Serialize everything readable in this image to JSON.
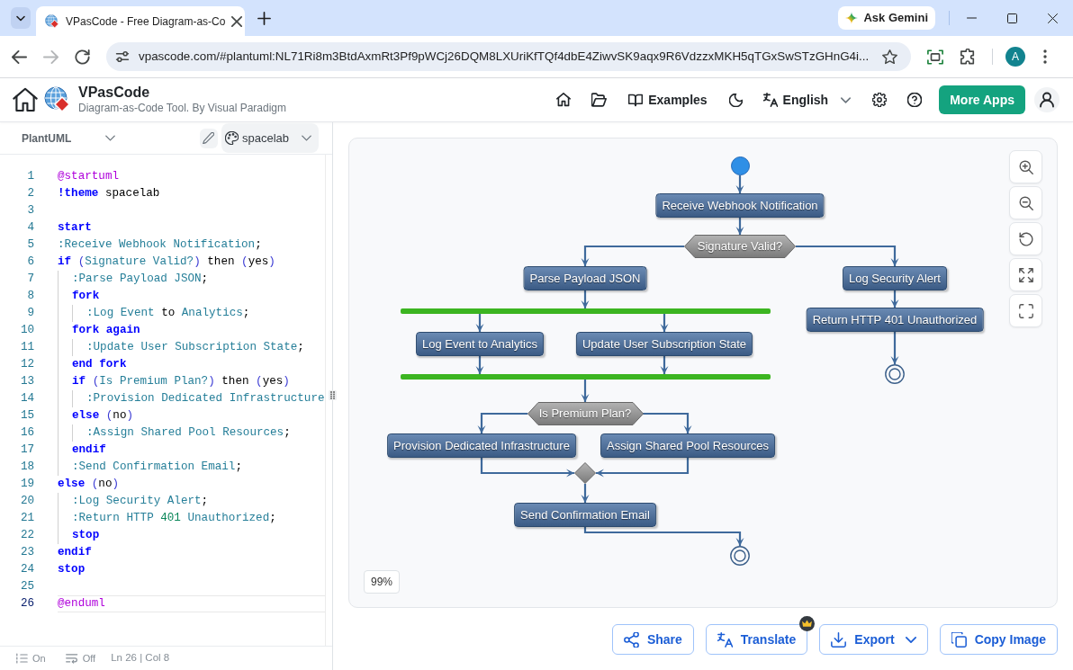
{
  "browser": {
    "tab_title": "VPasCode - Free Diagram-as-Co",
    "gemini": "Ask Gemini",
    "forward_disabled": true,
    "url": "vpascode.com/#plantuml:NL71Ri8m3BtdAxmRt3Pf9pWCj26DQM8LXUriKfTQf4dbE4ZiwvSK9aqx9R6VdzzxMKH5qTGxSwSTzGHnG4i...",
    "profile_initial": "A"
  },
  "header": {
    "title": "VPasCode",
    "subtitle": "Diagram-as-Code Tool. By Visual Paradigm",
    "examples": "Examples",
    "language": "English",
    "more_apps": "More Apps"
  },
  "editor": {
    "language": "PlantUML",
    "theme": "spacelab",
    "lines": [
      {
        "number": "1",
        "current": false,
        "tokens": [
          {
            "text": "@startuml",
            "kind": "directive"
          }
        ]
      },
      {
        "number": "2",
        "current": false,
        "tokens": [
          {
            "text": "!theme",
            "kind": "keyword"
          },
          {
            "text": " spacelab",
            "kind": "plain"
          }
        ]
      },
      {
        "number": "3",
        "current": false
      },
      {
        "number": "4",
        "current": false,
        "tokens": [
          {
            "text": "start",
            "kind": "keyword"
          }
        ]
      },
      {
        "number": "5",
        "current": false,
        "tokens": [
          {
            "text": ":Receive Webhook Notification",
            "kind": "label"
          },
          {
            "text": ";",
            "kind": "plain"
          }
        ]
      },
      {
        "number": "6",
        "current": false,
        "tokens": [
          {
            "text": "if",
            "kind": "keyword"
          },
          {
            "text": " (",
            "kind": "paren"
          },
          {
            "text": "Signature Valid?",
            "kind": "label"
          },
          {
            "text": ")",
            "kind": "paren"
          },
          {
            "text": " then ",
            "kind": "plain"
          },
          {
            "text": "(",
            "kind": "paren"
          },
          {
            "text": "yes",
            "kind": "plain"
          },
          {
            "text": ")",
            "kind": "paren"
          }
        ],
        "children": [
          {
            "number": "7",
            "current": false,
            "tokens": [
              {
                "text": ":Parse Payload JSON",
                "kind": "label"
              },
              {
                "text": ";",
                "kind": "plain"
              }
            ]
          },
          {
            "number": "8",
            "current": false,
            "tokens": [
              {
                "text": "fork",
                "kind": "keyword"
              }
            ],
            "children": [
              {
                "number": "9",
                "current": false,
                "tokens": [
                  {
                    "text": ":Log Event",
                    "kind": "label"
                  },
                  {
                    "text": " to ",
                    "kind": "plain"
                  },
                  {
                    "text": "Analytics",
                    "kind": "label"
                  },
                  {
                    "text": ";",
                    "kind": "plain"
                  }
                ]
              }
            ]
          },
          {
            "number": "10",
            "current": false,
            "tokens": [
              {
                "text": "fork again",
                "kind": "keyword"
              }
            ],
            "children": [
              {
                "number": "11",
                "current": false,
                "tokens": [
                  {
                    "text": ":Update User Subscription State",
                    "kind": "label"
                  },
                  {
                    "text": ";",
                    "kind": "plain"
                  }
                ]
              }
            ]
          },
          {
            "number": "12",
            "current": false,
            "tokens": [
              {
                "text": "end fork",
                "kind": "keyword"
              }
            ]
          },
          {
            "number": "13",
            "current": false,
            "tokens": [
              {
                "text": "if",
                "kind": "keyword"
              },
              {
                "text": " (",
                "kind": "paren"
              },
              {
                "text": "Is Premium Plan?",
                "kind": "label"
              },
              {
                "text": ")",
                "kind": "paren"
              },
              {
                "text": " then ",
                "kind": "plain"
              },
              {
                "text": "(",
                "kind": "paren"
              },
              {
                "text": "yes",
                "kind": "plain"
              },
              {
                "text": ")",
                "kind": "paren"
              }
            ],
            "children": [
              {
                "number": "14",
                "current": false,
                "tokens": [
                  {
                    "text": ":Provision Dedicated Infrastructure",
                    "kind": "label"
                  }
                ]
              }
            ]
          },
          {
            "number": "15",
            "current": false,
            "tokens": [
              {
                "text": "else",
                "kind": "keyword"
              },
              {
                "text": " (",
                "kind": "paren"
              },
              {
                "text": "no",
                "kind": "plain"
              },
              {
                "text": ")",
                "kind": "paren"
              }
            ],
            "children": [
              {
                "number": "16",
                "current": false,
                "tokens": [
                  {
                    "text": ":Assign Shared Pool Resources",
                    "kind": "label"
                  },
                  {
                    "text": ";",
                    "kind": "plain"
                  }
                ]
              }
            ]
          },
          {
            "number": "17",
            "current": false,
            "tokens": [
              {
                "text": "endif",
                "kind": "keyword"
              }
            ]
          },
          {
            "number": "18",
            "current": false,
            "tokens": [
              {
                "text": ":Send Confirmation Email",
                "kind": "label"
              },
              {
                "text": ";",
                "kind": "plain"
              }
            ]
          }
        ]
      },
      {
        "number": "19",
        "current": false,
        "tokens": [
          {
            "text": "else",
            "kind": "keyword"
          },
          {
            "text": " (",
            "kind": "paren"
          },
          {
            "text": "no",
            "kind": "plain"
          },
          {
            "text": ")",
            "kind": "paren"
          }
        ],
        "children": [
          {
            "number": "20",
            "current": false,
            "tokens": [
              {
                "text": ":Log Security Alert",
                "kind": "label"
              },
              {
                "text": ";",
                "kind": "plain"
              }
            ]
          },
          {
            "number": "21",
            "current": false,
            "tokens": [
              {
                "text": ":Return HTTP ",
                "kind": "label"
              },
              {
                "text": "401",
                "kind": "number"
              },
              {
                "text": " Unauthorized",
                "kind": "label"
              },
              {
                "text": ";",
                "kind": "plain"
              }
            ]
          },
          {
            "number": "22",
            "current": false,
            "tokens": [
              {
                "text": "stop",
                "kind": "keyword"
              }
            ]
          }
        ]
      },
      {
        "number": "23",
        "current": false,
        "tokens": [
          {
            "text": "endif",
            "kind": "keyword"
          }
        ]
      },
      {
        "number": "24",
        "current": false,
        "tokens": [
          {
            "text": "stop",
            "kind": "keyword"
          }
        ]
      },
      {
        "number": "25",
        "current": false
      },
      {
        "number": "26",
        "current": true,
        "tokens": [
          {
            "text": "@enduml",
            "kind": "directive"
          }
        ]
      }
    ],
    "status": {
      "line_numbers": "On",
      "word_wrap": "Off",
      "position": "Ln 26 | Col 8"
    }
  },
  "diagram": {
    "nodes": [
      {
        "kind": "start"
      },
      {
        "kind": "action",
        "label": "Receive Webhook Notification"
      },
      {
        "kind": "decision",
        "label": "Signature Valid?"
      },
      {
        "kind": "action",
        "label": "Parse Payload JSON"
      },
      {
        "kind": "action",
        "label": "Log Security Alert"
      },
      {
        "kind": "action",
        "label": "Return HTTP 401 Unauthorized"
      },
      {
        "kind": "end"
      },
      {
        "kind": "fork"
      },
      {
        "kind": "action",
        "label": "Log Event to Analytics"
      },
      {
        "kind": "action",
        "label": "Update User Subscription State"
      },
      {
        "kind": "fork"
      },
      {
        "kind": "decision",
        "label": "Is Premium Plan?"
      },
      {
        "kind": "action",
        "label": "Provision Dedicated Infrastructure"
      },
      {
        "kind": "action",
        "label": "Assign Shared Pool Resources"
      },
      {
        "kind": "merge"
      },
      {
        "kind": "action",
        "label": "Send Confirmation Email"
      },
      {
        "kind": "end"
      }
    ],
    "zoom": "99%"
  },
  "actions": [
    {
      "label": "Share",
      "premium": false,
      "dropdown": false
    },
    {
      "label": "Translate",
      "premium": true,
      "dropdown": false
    },
    {
      "label": "Export",
      "premium": false,
      "dropdown": true
    },
    {
      "label": "Copy Image",
      "premium": false,
      "dropdown": false
    }
  ]
}
